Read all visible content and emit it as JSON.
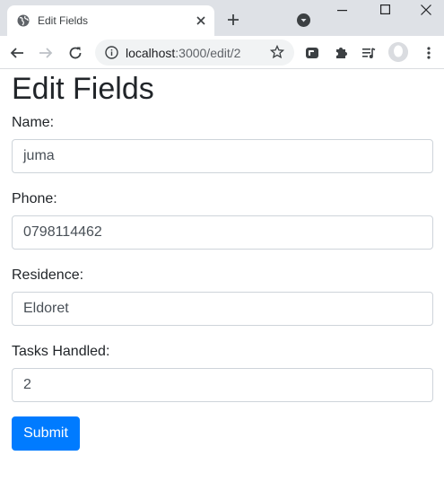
{
  "browser": {
    "tab_title": "Edit Fields",
    "url_host": "localhost",
    "url_path": ":3000/edit/2"
  },
  "page": {
    "heading": "Edit Fields",
    "fields": [
      {
        "label": "Name:",
        "value": "juma"
      },
      {
        "label": "Phone:",
        "value": "0798114462"
      },
      {
        "label": "Residence:",
        "value": "Eldoret"
      },
      {
        "label": "Tasks Handled:",
        "value": "2"
      }
    ],
    "submit_label": "Submit"
  },
  "colors": {
    "primary_button": "#007bff",
    "tabstrip": "#dee1e6"
  },
  "icons": [
    "globe-icon",
    "close-icon",
    "plus-icon",
    "tab-search-icon",
    "minimize-icon",
    "maximize-icon",
    "window-close-icon",
    "back-icon",
    "forward-icon",
    "reload-icon",
    "info-icon",
    "star-icon",
    "extension-icon",
    "puzzle-icon",
    "media-icon",
    "avatar",
    "more-icon"
  ]
}
